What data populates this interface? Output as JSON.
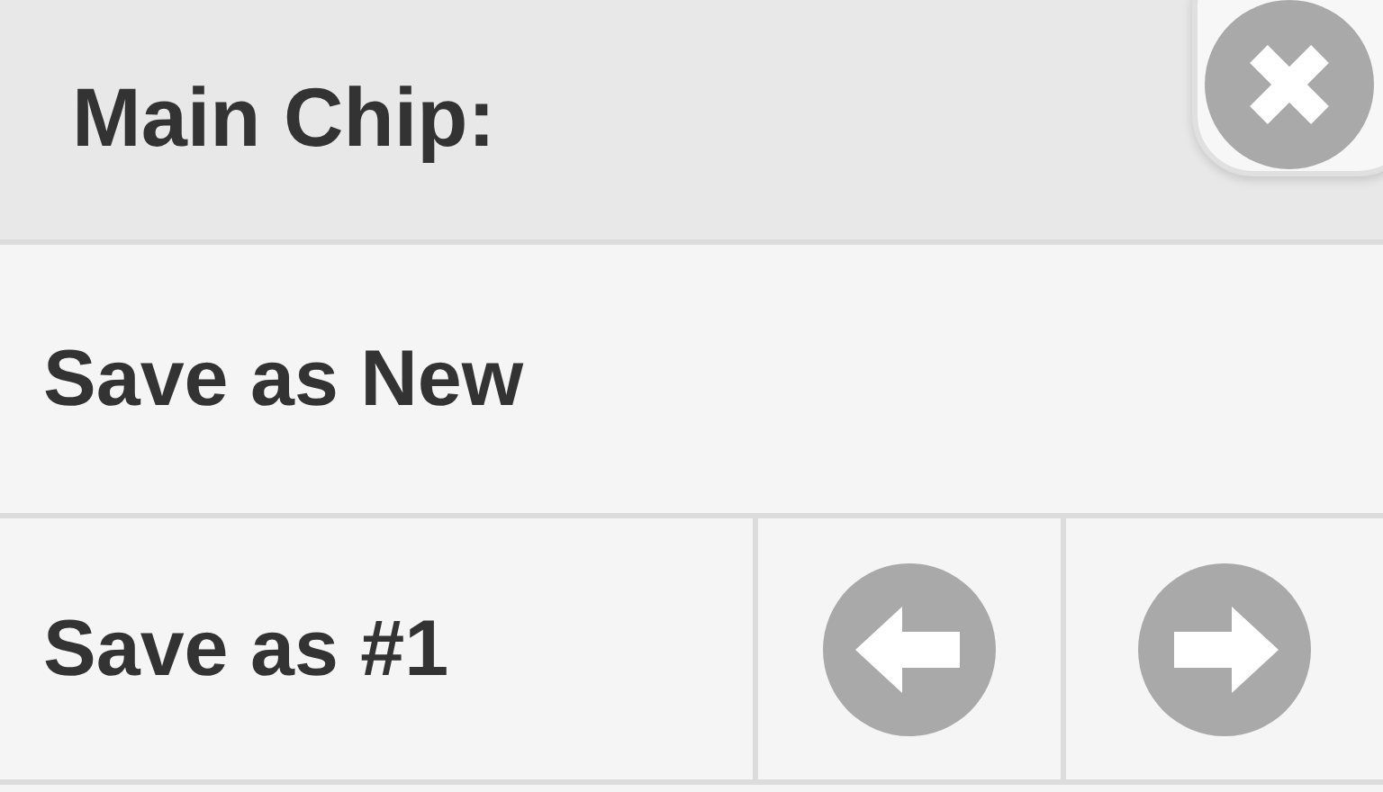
{
  "header": {
    "title": "Main Chip:"
  },
  "save_new": {
    "label": "Save as New"
  },
  "save_slot": {
    "label": "Save as #1"
  }
}
